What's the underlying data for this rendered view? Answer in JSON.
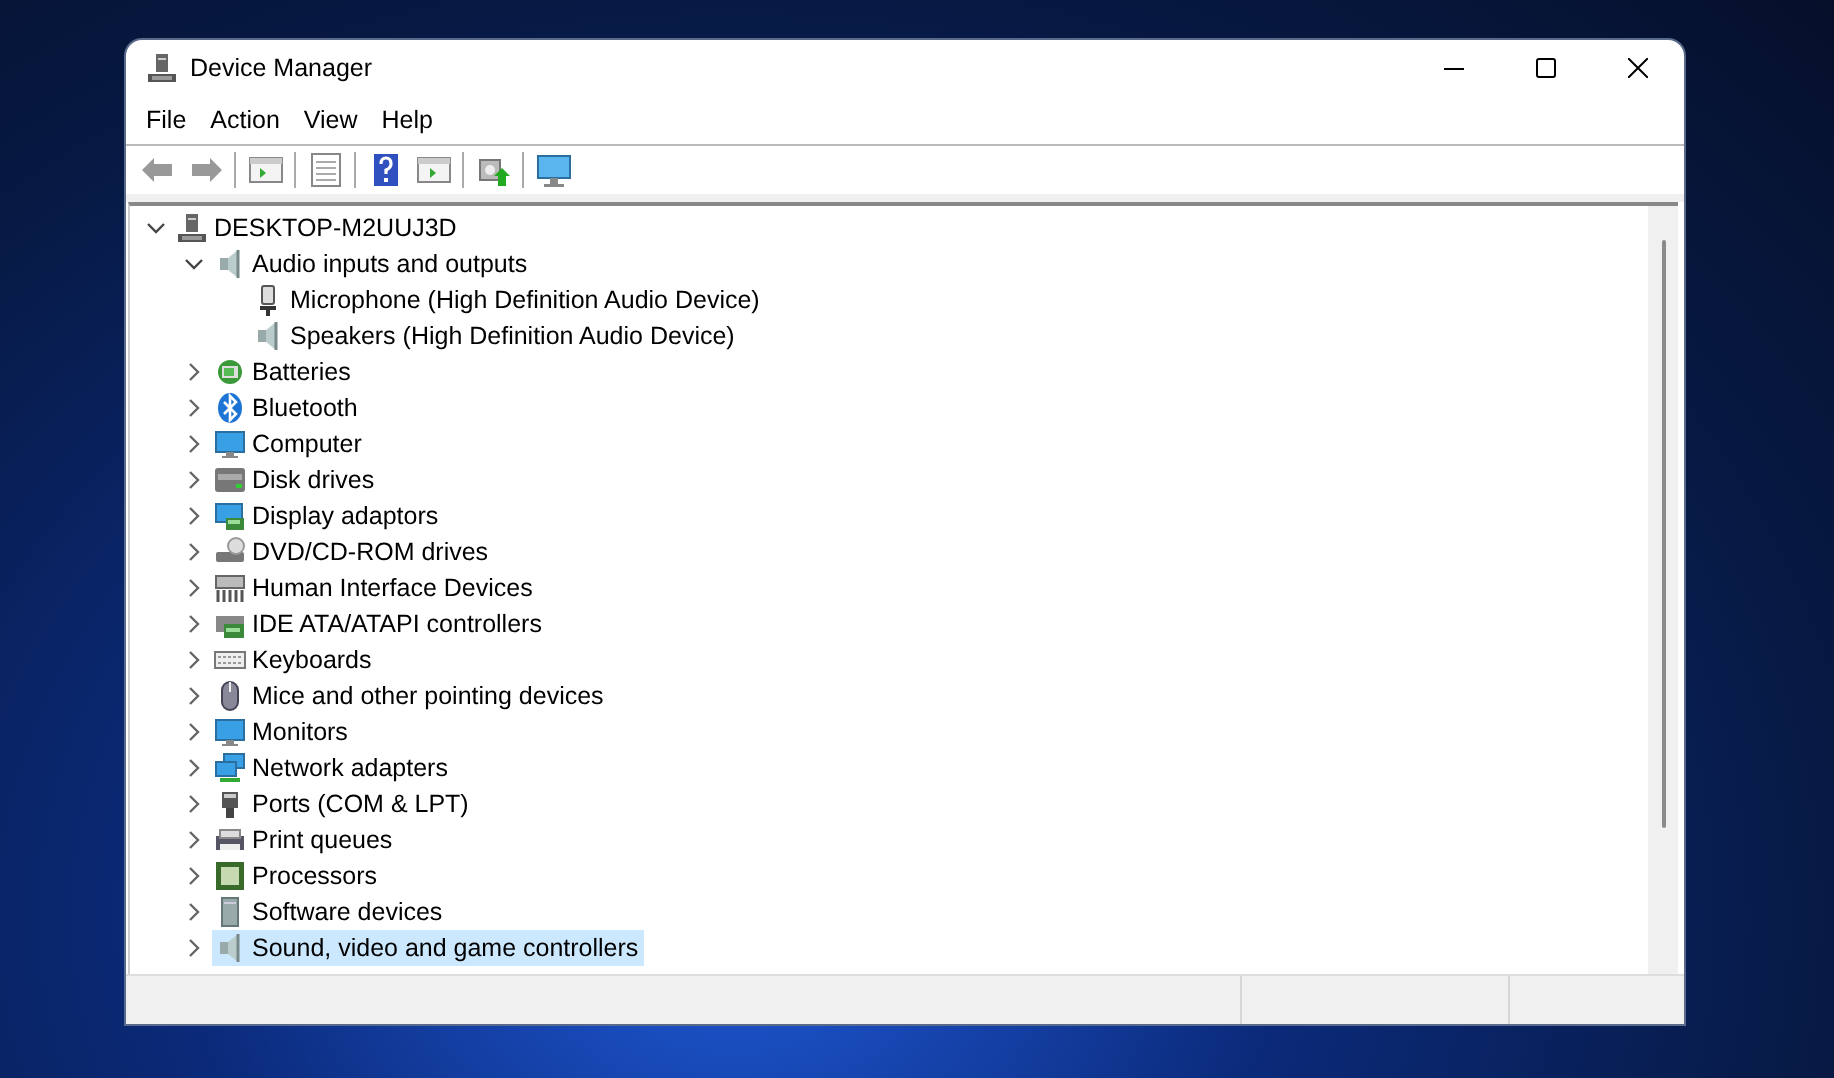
{
  "window": {
    "title": "Device Manager"
  },
  "menu": [
    {
      "label": "File"
    },
    {
      "label": "Action"
    },
    {
      "label": "View"
    },
    {
      "label": "Help"
    }
  ],
  "tree": {
    "label": "DESKTOP-M2UUJ3D",
    "kind": "computer-tower",
    "expanded": true,
    "selected": false,
    "children": [
      {
        "label": "Audio inputs and outputs",
        "kind": "speaker",
        "expanded": true,
        "selected": false,
        "children": [
          {
            "label": "Microphone (High Definition Audio Device)",
            "kind": "microphone",
            "selected": false
          },
          {
            "label": "Speakers (High Definition Audio Device)",
            "kind": "speaker",
            "selected": false
          }
        ]
      },
      {
        "label": "Batteries",
        "kind": "battery",
        "expanded": false,
        "selected": false
      },
      {
        "label": "Bluetooth",
        "kind": "bluetooth",
        "expanded": false,
        "selected": false
      },
      {
        "label": "Computer",
        "kind": "monitor",
        "expanded": false,
        "selected": false
      },
      {
        "label": "Disk drives",
        "kind": "drive",
        "expanded": false,
        "selected": false
      },
      {
        "label": "Display adaptors",
        "kind": "display-adapter",
        "expanded": false,
        "selected": false
      },
      {
        "label": "DVD/CD-ROM drives",
        "kind": "disc-drive",
        "expanded": false,
        "selected": false
      },
      {
        "label": "Human Interface Devices",
        "kind": "hid",
        "expanded": false,
        "selected": false
      },
      {
        "label": "IDE ATA/ATAPI controllers",
        "kind": "card",
        "expanded": false,
        "selected": false
      },
      {
        "label": "Keyboards",
        "kind": "keyboard",
        "expanded": false,
        "selected": false
      },
      {
        "label": "Mice and other pointing devices",
        "kind": "mouse",
        "expanded": false,
        "selected": false
      },
      {
        "label": "Monitors",
        "kind": "monitor",
        "expanded": false,
        "selected": false
      },
      {
        "label": "Network adapters",
        "kind": "network",
        "expanded": false,
        "selected": false
      },
      {
        "label": "Ports (COM & LPT)",
        "kind": "port",
        "expanded": false,
        "selected": false
      },
      {
        "label": "Print queues",
        "kind": "printer",
        "expanded": false,
        "selected": false
      },
      {
        "label": "Processors",
        "kind": "chip",
        "expanded": false,
        "selected": false
      },
      {
        "label": "Software devices",
        "kind": "software",
        "expanded": false,
        "selected": false
      },
      {
        "label": "Sound, video and game controllers",
        "kind": "speaker",
        "expanded": false,
        "selected": true
      }
    ]
  }
}
